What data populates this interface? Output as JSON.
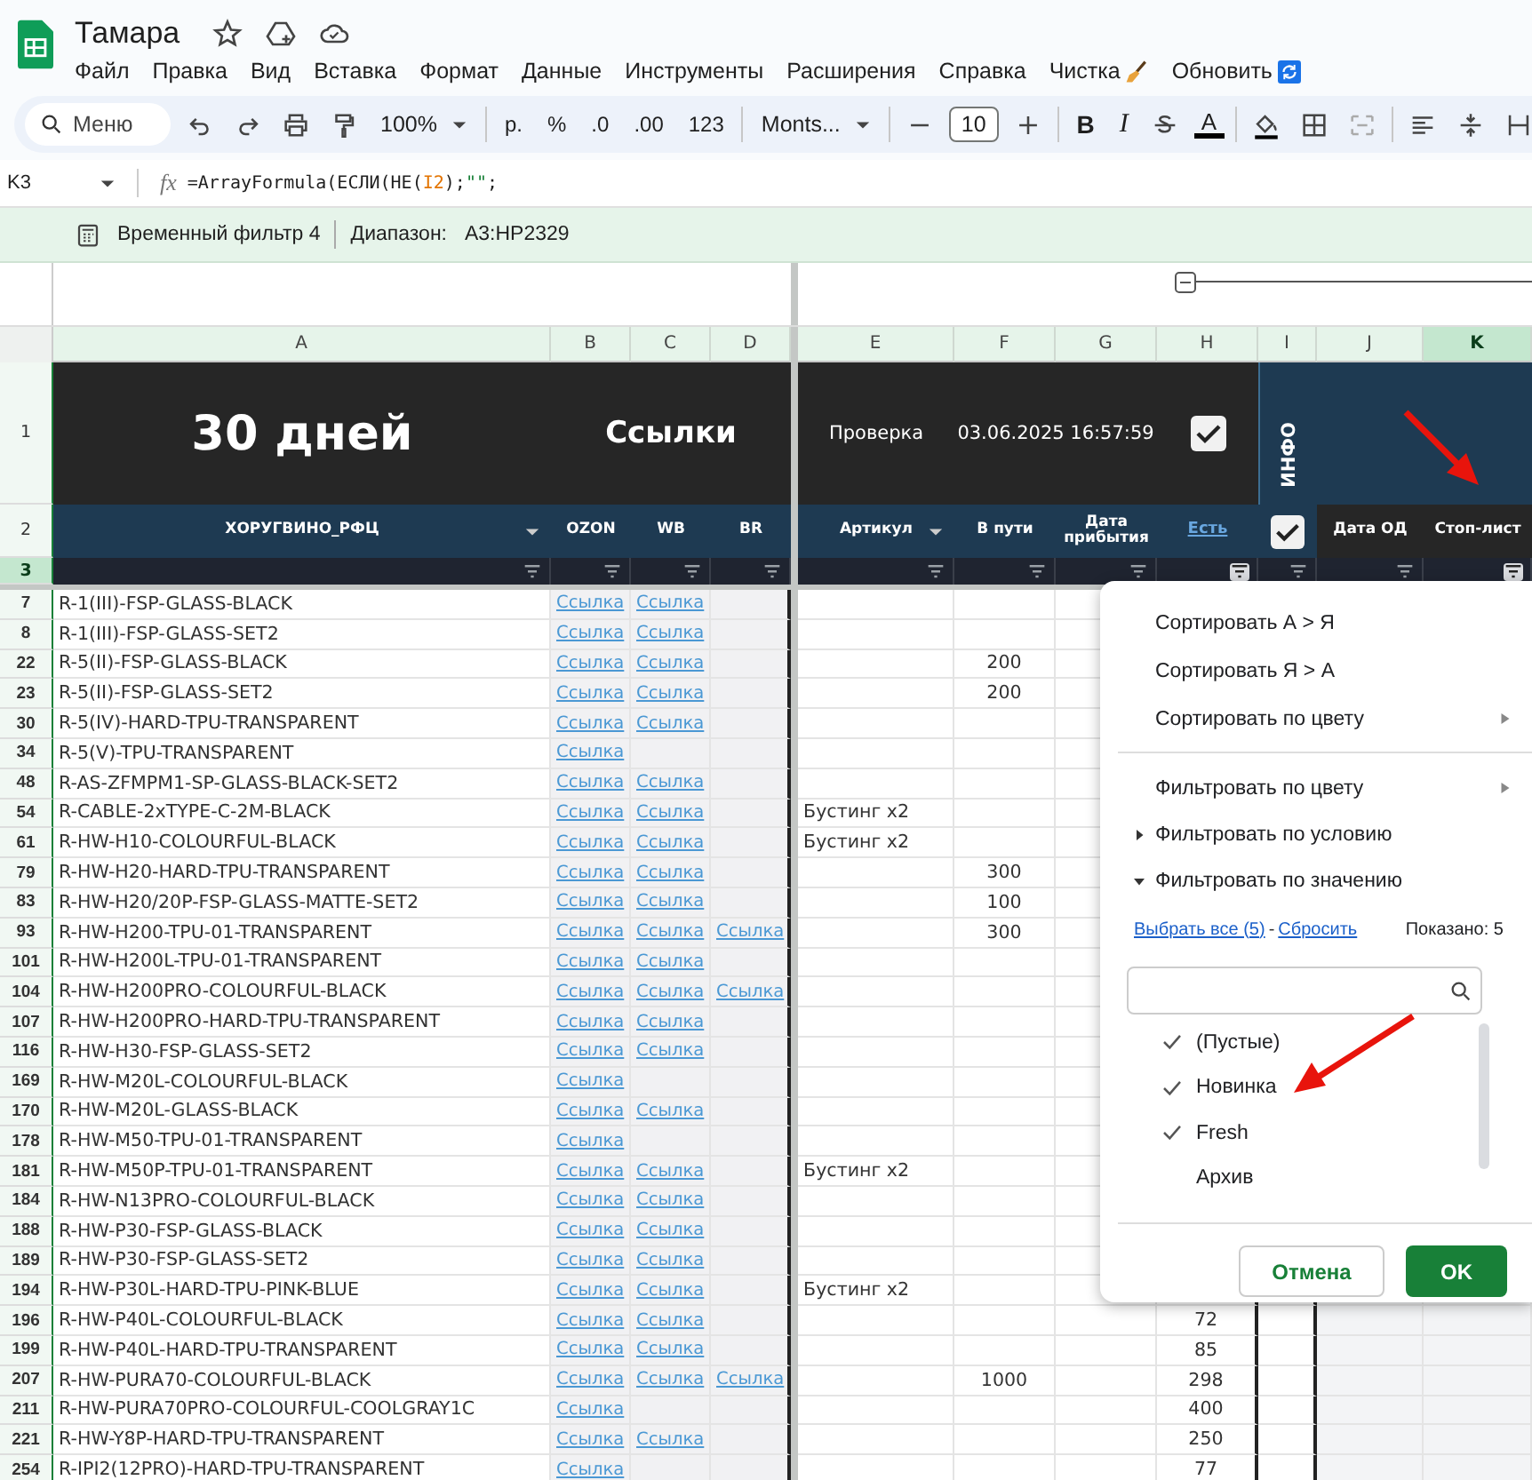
{
  "doc": {
    "title": "Тамара"
  },
  "menubar": [
    {
      "label": "Файл",
      "kind": "plain"
    },
    {
      "label": "Правка",
      "kind": "plain"
    },
    {
      "label": "Вид",
      "kind": "plain"
    },
    {
      "label": "Вставка",
      "kind": "plain"
    },
    {
      "label": "Формат",
      "kind": "plain"
    },
    {
      "label": "Данные",
      "kind": "plain"
    },
    {
      "label": "Инструменты",
      "kind": "plain"
    },
    {
      "label": "Расширения",
      "kind": "plain"
    },
    {
      "label": "Справка",
      "kind": "plain"
    },
    {
      "label": "Чистка",
      "kind": "broom"
    },
    {
      "label": "Обновить",
      "kind": "refresh"
    }
  ],
  "toolbar": [
    {
      "kind": "search",
      "placeholder": "Меню"
    },
    {
      "kind": "undo"
    },
    {
      "kind": "redo"
    },
    {
      "kind": "print"
    },
    {
      "kind": "paint-format"
    },
    {
      "kind": "dropdown",
      "label": "100%"
    },
    {
      "kind": "separator"
    },
    {
      "kind": "text",
      "label": "р."
    },
    {
      "kind": "text",
      "label": "%"
    },
    {
      "kind": "text",
      "label": ".0"
    },
    {
      "kind": "text",
      "label": ".00"
    },
    {
      "kind": "text",
      "label": "123"
    },
    {
      "kind": "separator"
    },
    {
      "kind": "dropdown",
      "label": "Monts..."
    },
    {
      "kind": "separator"
    },
    {
      "kind": "minus"
    },
    {
      "kind": "field",
      "label": "10"
    },
    {
      "kind": "plus"
    },
    {
      "kind": "separator"
    },
    {
      "kind": "bold",
      "label": "B"
    },
    {
      "kind": "italic",
      "label": "I"
    },
    {
      "kind": "strike"
    },
    {
      "kind": "text-color",
      "label": "A"
    },
    {
      "kind": "separator"
    },
    {
      "kind": "fill"
    },
    {
      "kind": "borders"
    },
    {
      "kind": "merge"
    },
    {
      "kind": "separator"
    },
    {
      "kind": "align"
    },
    {
      "kind": "valign"
    },
    {
      "kind": "wrap"
    }
  ],
  "formula_bar": {
    "cell": "K3",
    "fx": "fx",
    "before": "=ArrayFormula(ЕСЛИ(НЕ(",
    "ref": "I2",
    "middle": ");",
    "string": "\"\"",
    "after": ";"
  },
  "filter_bar": {
    "name": "Временный фильтр 4",
    "range_label": "Диапазон:",
    "range": "A3:HP2329"
  },
  "columns": [
    {
      "letter": "A",
      "selected": false
    },
    {
      "letter": "B",
      "selected": false
    },
    {
      "letter": "C",
      "selected": false
    },
    {
      "letter": "D",
      "selected": false
    },
    {
      "letter": "E",
      "selected": false
    },
    {
      "letter": "F",
      "selected": false
    },
    {
      "letter": "G",
      "selected": false
    },
    {
      "letter": "H",
      "selected": false
    },
    {
      "letter": "I",
      "selected": false
    },
    {
      "letter": "J",
      "selected": false
    },
    {
      "letter": "K",
      "selected": true
    }
  ],
  "header_rows": [
    {
      "num": "1",
      "selected": false
    },
    {
      "num": "2",
      "selected": false
    },
    {
      "num": "3",
      "selected": true
    }
  ],
  "row1": {
    "title": "30 дней",
    "links_title": "Ссылки",
    "check_label": "Проверка",
    "timestamp": "03.06.2025 16:57:59",
    "checked": true,
    "info": "ИНФО"
  },
  "row2": [
    {
      "kind": "label",
      "label": "ХОРУГВИНО_РФЦ",
      "dropdown": true
    },
    {
      "kind": "label",
      "label": "OZON",
      "dropdown": false
    },
    {
      "kind": "label",
      "label": "WB",
      "dropdown": false
    },
    {
      "kind": "label",
      "label": "BR",
      "dropdown": false
    },
    {
      "kind": "label",
      "label": "Артикул",
      "dropdown": true
    },
    {
      "kind": "label",
      "label": "В пути",
      "dropdown": false
    },
    {
      "kind": "label",
      "label": "Дата прибытия",
      "dropdown": false
    },
    {
      "kind": "link",
      "label": "Есть"
    },
    {
      "kind": "checkbox",
      "checked": true
    },
    {
      "kind": "label",
      "label": "Дата ОД",
      "dropdown": false
    },
    {
      "kind": "label",
      "label": "Стоп-лист",
      "dropdown": false
    }
  ],
  "filters": [
    {
      "active": false
    },
    {
      "active": false
    },
    {
      "active": false
    },
    {
      "active": false
    },
    {
      "active": false
    },
    {
      "active": false
    },
    {
      "active": false
    },
    {
      "active": true
    },
    {
      "active": false
    },
    {
      "active": false
    },
    {
      "active": true
    }
  ],
  "rows": [
    {
      "num": "7",
      "name": "R-1(III)-FSP-GLASS-BLACK",
      "links": [
        "Ссылка",
        "Ссылка"
      ]
    },
    {
      "num": "8",
      "name": "R-1(III)-FSP-GLASS-SET2",
      "links": [
        "Ссылка",
        "Ссылка"
      ]
    },
    {
      "num": "22",
      "name": "R-5(II)-FSP-GLASS-BLACK",
      "links": [
        "Ссылка",
        "Ссылка"
      ],
      "transit": "200"
    },
    {
      "num": "23",
      "name": "R-5(II)-FSP-GLASS-SET2",
      "links": [
        "Ссылка",
        "Ссылка"
      ],
      "transit": "200"
    },
    {
      "num": "30",
      "name": "R-5(IV)-HARD-TPU-TRANSPARENT",
      "links": [
        "Ссылка",
        "Ссылка"
      ]
    },
    {
      "num": "34",
      "name": "R-5(V)-TPU-TRANSPARENT",
      "links": [
        "Ссылка"
      ]
    },
    {
      "num": "48",
      "name": "R-AS-ZFMPM1-SP-GLASS-BLACK-SET2",
      "links": [
        "Ссылка",
        "Ссылка"
      ]
    },
    {
      "num": "54",
      "name": "R-CABLE-2xTYPE-C-2M-BLACK",
      "links": [
        "Ссылка",
        "Ссылка"
      ],
      "article": "Бустинг x2"
    },
    {
      "num": "61",
      "name": "R-HW-H10-COLOURFUL-BLACK",
      "links": [
        "Ссылка",
        "Ссылка"
      ],
      "article": "Бустинг x2"
    },
    {
      "num": "79",
      "name": "R-HW-H20-HARD-TPU-TRANSPARENT",
      "links": [
        "Ссылка",
        "Ссылка"
      ],
      "transit": "300"
    },
    {
      "num": "83",
      "name": "R-HW-H20/20P-FSP-GLASS-MATTE-SET2",
      "links": [
        "Ссылка",
        "Ссылка"
      ],
      "transit": "100"
    },
    {
      "num": "93",
      "name": "R-HW-H200-TPU-01-TRANSPARENT",
      "links": [
        "Ссылка",
        "Ссылка",
        "Ссылка"
      ],
      "transit": "300"
    },
    {
      "num": "101",
      "name": "R-HW-H200L-TPU-01-TRANSPARENT",
      "links": [
        "Ссылка",
        "Ссылка"
      ]
    },
    {
      "num": "104",
      "name": "R-HW-H200PRO-COLOURFUL-BLACK",
      "links": [
        "Ссылка",
        "Ссылка",
        "Ссылка"
      ]
    },
    {
      "num": "107",
      "name": "R-HW-H200PRO-HARD-TPU-TRANSPARENT",
      "links": [
        "Ссылка",
        "Ссылка"
      ]
    },
    {
      "num": "116",
      "name": "R-HW-H30-FSP-GLASS-SET2",
      "links": [
        "Ссылка",
        "Ссылка"
      ]
    },
    {
      "num": "169",
      "name": "R-HW-M20L-COLOURFUL-BLACK",
      "links": [
        "Ссылка"
      ]
    },
    {
      "num": "170",
      "name": "R-HW-M20L-GLASS-BLACK",
      "links": [
        "Ссылка",
        "Ссылка"
      ]
    },
    {
      "num": "178",
      "name": "R-HW-M50-TPU-01-TRANSPARENT",
      "links": [
        "Ссылка"
      ]
    },
    {
      "num": "181",
      "name": "R-HW-M50P-TPU-01-TRANSPARENT",
      "links": [
        "Ссылка",
        "Ссылка"
      ],
      "article": "Бустинг x2"
    },
    {
      "num": "184",
      "name": "R-HW-N13PRO-COLOURFUL-BLACK",
      "links": [
        "Ссылка",
        "Ссылка"
      ]
    },
    {
      "num": "188",
      "name": "R-HW-P30-FSP-GLASS-BLACK",
      "links": [
        "Ссылка",
        "Ссылка"
      ]
    },
    {
      "num": "189",
      "name": "R-HW-P30-FSP-GLASS-SET2",
      "links": [
        "Ссылка",
        "Ссылка"
      ]
    },
    {
      "num": "194",
      "name": "R-HW-P30L-HARD-TPU-PINK-BLUE",
      "links": [
        "Ссылка",
        "Ссылка"
      ],
      "article": "Бустинг x2"
    },
    {
      "num": "196",
      "name": "R-HW-P40L-COLOURFUL-BLACK",
      "links": [
        "Ссылка",
        "Ссылка"
      ],
      "stock": "72"
    },
    {
      "num": "199",
      "name": "R-HW-P40L-HARD-TPU-TRANSPARENT",
      "links": [
        "Ссылка",
        "Ссылка"
      ],
      "stock": "85"
    },
    {
      "num": "207",
      "name": "R-HW-PURA70-COLOURFUL-BLACK",
      "links": [
        "Ссылка",
        "Ссылка",
        "Ссылка"
      ],
      "transit": "1000",
      "stock": "298"
    },
    {
      "num": "211",
      "name": "R-HW-PURA70PRO-COLOURFUL-COOLGRAY1C",
      "links": [
        "Ссылка"
      ],
      "stock": "400"
    },
    {
      "num": "221",
      "name": "R-HW-Y8P-HARD-TPU-TRANSPARENT",
      "links": [
        "Ссылка",
        "Ссылка"
      ],
      "stock": "250"
    },
    {
      "num": "254",
      "name": "R-IPI2(12PRO)-HARD-TPU-TRANSPARENT",
      "links": [
        "Ссылка"
      ],
      "stock": "77"
    }
  ],
  "filter_menu": {
    "sort_items": [
      {
        "label": "Сортировать А > Я",
        "kind": "action"
      },
      {
        "label": "Сортировать Я > А",
        "kind": "action"
      },
      {
        "label": "Сортировать по цвету",
        "kind": "submenu"
      }
    ],
    "filter_items": [
      {
        "label": "Фильтровать по цвету",
        "kind": "submenu"
      },
      {
        "label": "Фильтровать по условию",
        "kind": "section",
        "expanded": false
      },
      {
        "label": "Фильтровать по значению",
        "kind": "section",
        "expanded": true
      }
    ],
    "select_all": "Выбрать все (5)",
    "link_separator": "-",
    "reset": "Сбросить",
    "shown": "Показано: 5",
    "values": [
      {
        "label": "(Пустые)",
        "checked": true
      },
      {
        "label": "Новинка",
        "checked": true
      },
      {
        "label": "Fresh",
        "checked": true
      },
      {
        "label": "Архив",
        "checked": false
      }
    ],
    "cancel": "Отмена",
    "ok": "OK"
  }
}
